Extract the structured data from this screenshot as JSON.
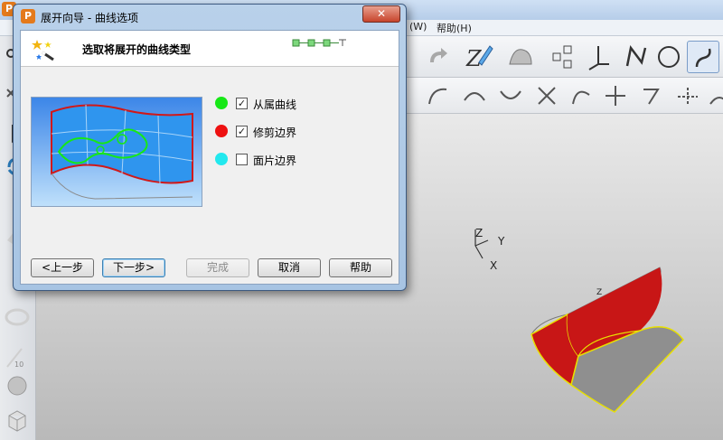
{
  "app": {
    "title_visible_fragment": "",
    "menus": [
      "(W)",
      "帮助(H)"
    ]
  },
  "viewport": {
    "axis_z": "Z",
    "axis_y": "Y",
    "axis_x": "X",
    "model_label": "Z"
  },
  "dialog": {
    "title": "展开向导 - 曲线选项",
    "close_glyph": "✕",
    "heading": "选取将展开的曲线类型",
    "options": [
      {
        "label": "从属曲线",
        "checked": true,
        "color": "#17e817"
      },
      {
        "label": "修剪边界",
        "checked": true,
        "color": "#ee1111"
      },
      {
        "label": "面片边界",
        "checked": false,
        "color": "#22e8ee"
      }
    ],
    "buttons": {
      "back": "<上一步",
      "next": "下一步>",
      "finish": "完成",
      "cancel": "取消",
      "help": "帮助"
    }
  },
  "icons": {
    "wizard": "wand-stars-icon",
    "step_indicator": "step-progress-icon"
  },
  "colors": {
    "dialog_frame": "#a7c4e3",
    "close_button": "#c7442b",
    "preview_bg": "#3c86e8"
  }
}
